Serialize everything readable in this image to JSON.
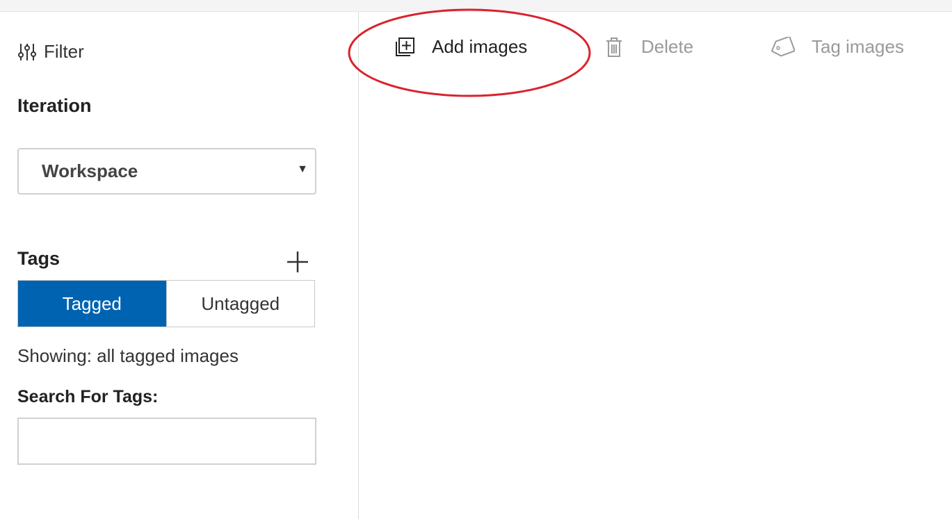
{
  "sidebar": {
    "filter_label": "Filter",
    "iteration_title": "Iteration",
    "iteration_select_value": "Workspace",
    "tags_title": "Tags",
    "toggle": {
      "tagged_label": "Tagged",
      "untagged_label": "Untagged",
      "selected": "Tagged"
    },
    "showing_text": "Showing: all tagged images",
    "search_title": "Search For Tags:",
    "search_value": ""
  },
  "toolbar": {
    "add_images_label": "Add images",
    "delete_label": "Delete",
    "tag_images_label": "Tag images"
  },
  "colors": {
    "accent": "#0063b1",
    "disabled_text": "#9a9a9a",
    "highlight_annotation": "#d9232e"
  },
  "icons": {
    "filter": "sliders-icon",
    "add_images": "add-image-icon",
    "delete": "trash-icon",
    "tag_images": "tag-icon",
    "add_tag": "plus-icon",
    "dropdown": "caret-down-icon"
  }
}
